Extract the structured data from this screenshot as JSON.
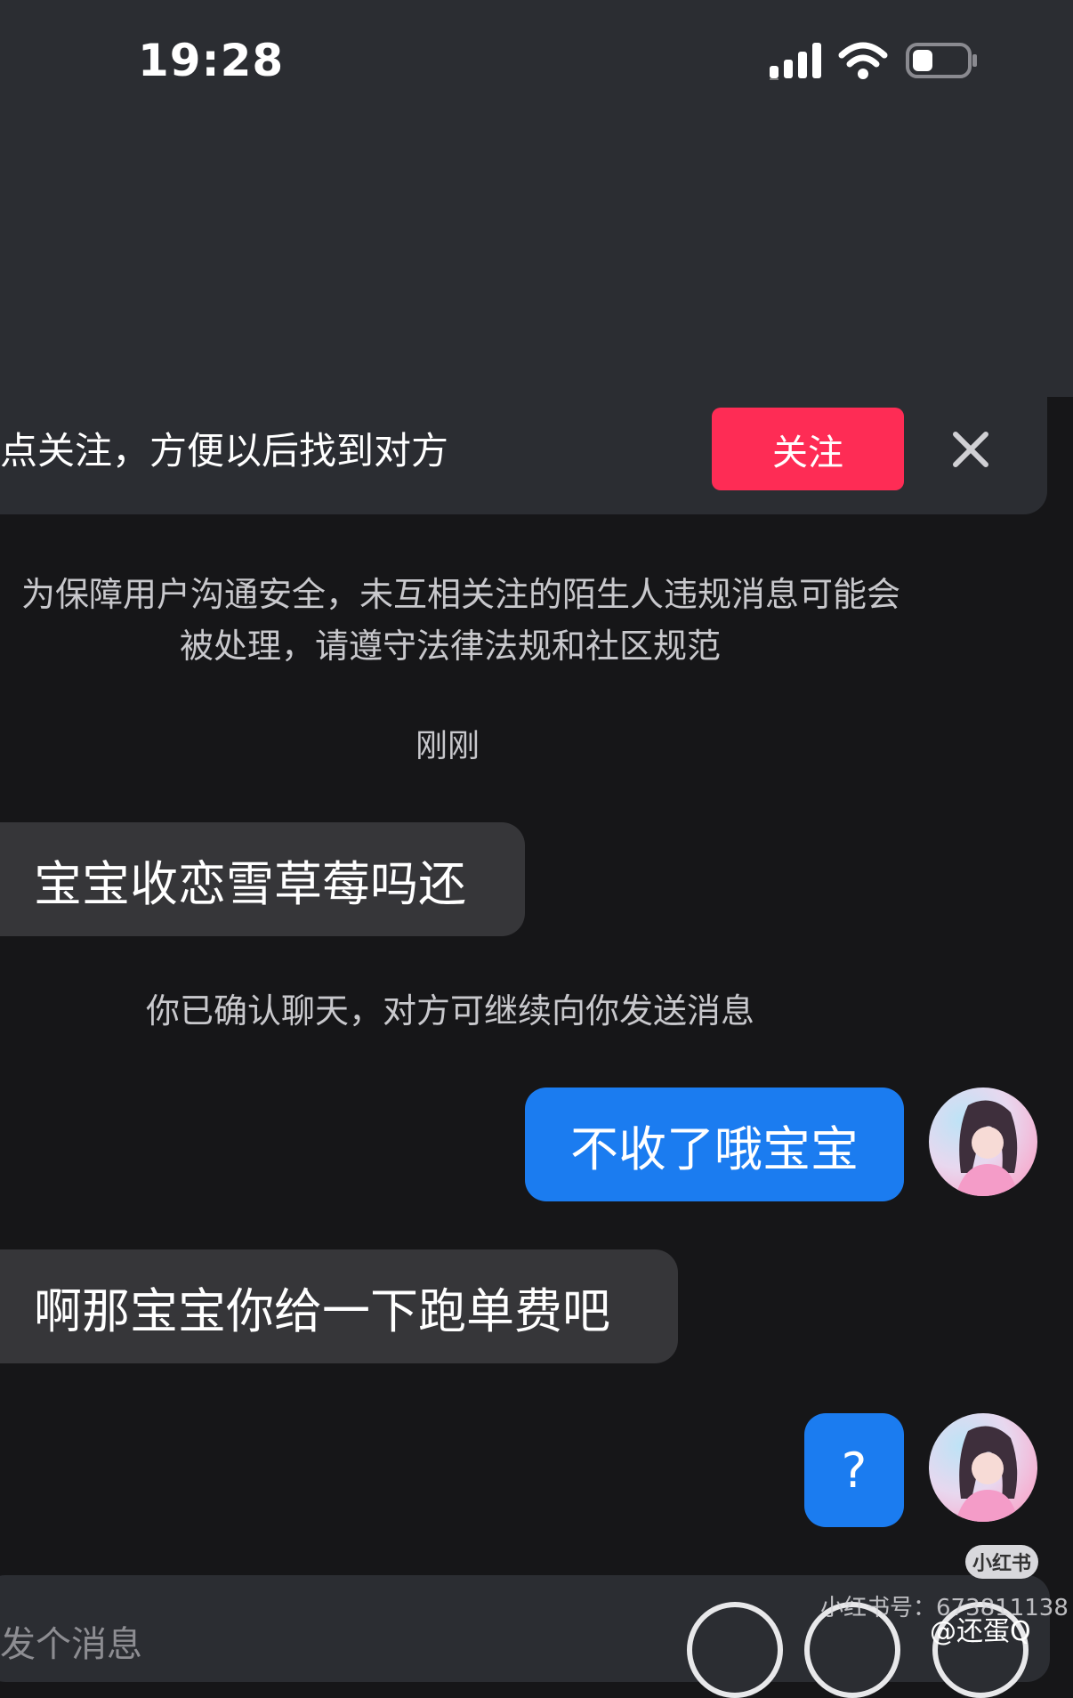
{
  "status_bar": {
    "time": "19:28"
  },
  "follow_banner": {
    "text": "点关注，方便以后找到对方",
    "button_label": "关注"
  },
  "notice": {
    "line1": "为保障用户沟通安全，未互相关注的陌生人违规消息可能会",
    "line2": "被处理，请遵守法律法规和社区规范"
  },
  "timestamp": "刚刚",
  "messages": [
    {
      "side": "in",
      "text": "宝宝收恋雪草莓吗还"
    },
    {
      "side": "system",
      "text": "你已确认聊天，对方可继续向你发送消息"
    },
    {
      "side": "out",
      "text": "不收了哦宝宝"
    },
    {
      "side": "in",
      "text": "啊那宝宝你给一下跑单费吧"
    },
    {
      "side": "out",
      "text": "?"
    }
  ],
  "input": {
    "placeholder": "发个消息"
  },
  "watermark": {
    "logo": "小红书",
    "id_text": "小红书号：673811138",
    "weibo_text": "@还蛋Q"
  },
  "colors": {
    "accent_follow": "#fe2c55",
    "outgoing_bubble": "#1b7cf0",
    "incoming_bubble": "#363639"
  }
}
